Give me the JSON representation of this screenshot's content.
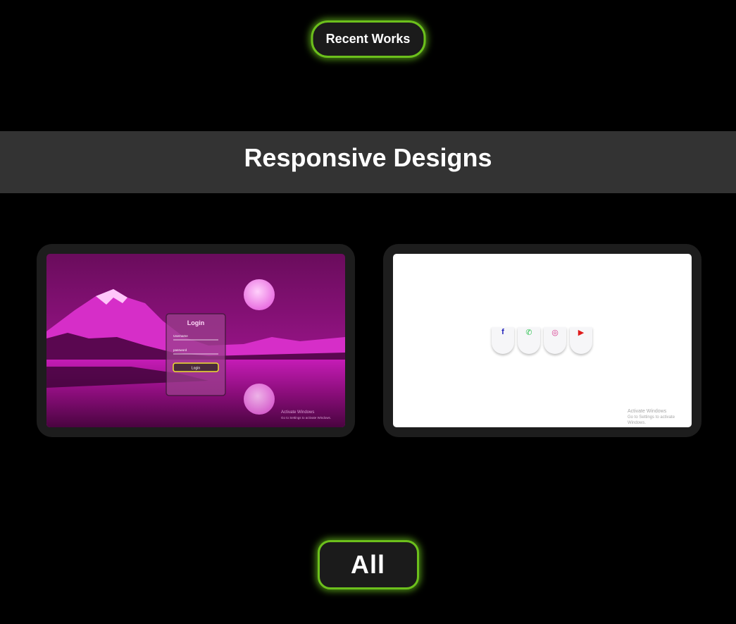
{
  "recent_works_label": "Recent Works",
  "section": {
    "title": "Responsive Designs"
  },
  "filter_all_label": "All",
  "projects": [
    {
      "login_title": "Login",
      "username_label": "Username",
      "password_label": "password",
      "login_button": "Login",
      "watermark_line1": "Activate Windows",
      "watermark_line2": "Go to Settings to activate Windows."
    },
    {
      "icons": [
        "facebook-icon",
        "whatsapp-icon",
        "instagram-icon",
        "youtube-icon"
      ],
      "icon_glyphs": [
        "f",
        "✆",
        "◎",
        "▶"
      ],
      "icon_colors": [
        "#2222bb",
        "#25c04a",
        "#d6338a",
        "#e01c1c"
      ],
      "watermark_line1": "Activate Windows",
      "watermark_line2": "Go to Settings to activate Windows."
    }
  ],
  "accent_color": "#6cc01c"
}
